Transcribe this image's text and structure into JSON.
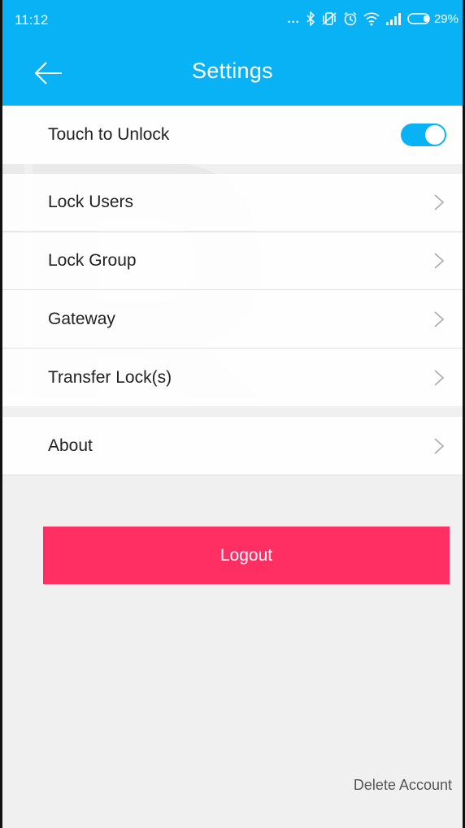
{
  "status_bar": {
    "time": "11:12",
    "icons": [
      "more-dots-icon",
      "bluetooth-icon",
      "vibrate-icon",
      "alarm-icon",
      "wifi-icon",
      "signal-icon",
      "battery-icon"
    ],
    "dots": "...",
    "battery_percent": "29%"
  },
  "app_bar": {
    "title": "Settings",
    "back_icon": "back-arrow-icon",
    "background_color": "#09b1f5"
  },
  "settings": {
    "touch_to_unlock": {
      "label": "Touch to Unlock",
      "enabled": true
    },
    "items": [
      {
        "label": "Lock Users"
      },
      {
        "label": "Lock Group"
      },
      {
        "label": "Gateway"
      },
      {
        "label": "Transfer Lock(s)"
      }
    ],
    "about": {
      "label": "About"
    }
  },
  "actions": {
    "logout_label": "Logout",
    "logout_color": "#ff2f63",
    "delete_account_label": "Delete Account"
  }
}
